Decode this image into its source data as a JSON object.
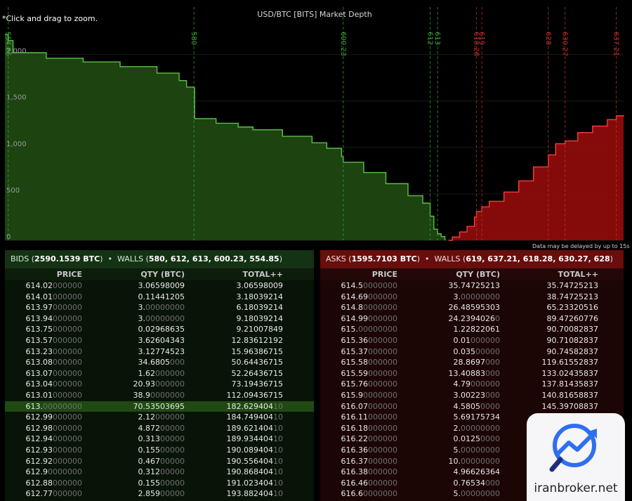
{
  "hint": "*Click and drag to zoom.",
  "delay_note": "Data may be delayed by up to 15s",
  "colors": {
    "bid": "#1f4a12",
    "bid_line": "#5cc24a",
    "ask": "#8c0c0c",
    "ask_line": "#ff3a3a"
  },
  "chart_data": {
    "type": "area",
    "title": "USD/BTC [BITS] Market Depth",
    "ylim": [
      0,
      2300
    ],
    "xlim": [
      554.4,
      638.2
    ],
    "y_ticks": [
      "0",
      "500",
      "1,000",
      "1,500",
      "2,000"
    ],
    "wall_labels": {
      "bids": [
        "554.85",
        "580",
        "600.23",
        "612",
        "613"
      ],
      "asks": [
        "618.28",
        "619",
        "628",
        "630.27",
        "637.21"
      ]
    },
    "bid_walls": [
      554.85,
      580,
      600.23,
      612,
      613
    ],
    "ask_walls": [
      618.28,
      619,
      628,
      630.27,
      637.21
    ],
    "series": [
      {
        "name": "Bids",
        "x": [
          554.4,
          554.85,
          555.5,
          560,
          565,
          570,
          575,
          578,
          579,
          580,
          580.1,
          583,
          586,
          588,
          592,
          596,
          598,
          600,
          600.23,
          603,
          606,
          609,
          611,
          612,
          612.5,
          613,
          613.5,
          614,
          614.02
        ],
        "y": [
          2215,
          2150,
          2020,
          1960,
          1920,
          1870,
          1800,
          1720,
          1650,
          1640,
          1310,
          1260,
          1220,
          1190,
          1120,
          1050,
          990,
          900,
          840,
          730,
          610,
          480,
          400,
          260,
          120,
          70,
          40,
          10,
          0
        ]
      },
      {
        "name": "Asks",
        "x": [
          614.5,
          615,
          616,
          617,
          618,
          618.28,
          619,
          620,
          622,
          624,
          626,
          628,
          629,
          630.27,
          632,
          634,
          636,
          637.21,
          638.2
        ],
        "y": [
          0,
          35,
          90,
          150,
          250,
          310,
          360,
          420,
          520,
          640,
          790,
          920,
          1040,
          1070,
          1160,
          1230,
          1300,
          1340,
          1350
        ]
      }
    ]
  },
  "bids": {
    "label": "BIDS",
    "total": "2590.1539 BTC",
    "walls_label": "WALLS",
    "walls": "580, 612, 613, 600.23, 554.85",
    "columns": [
      "PRICE",
      "QTY (BTC)",
      "TOTAL++"
    ],
    "rows": [
      [
        "614.02",
        "000000",
        "3.06598009",
        "",
        "3.06598009",
        ""
      ],
      [
        "614.01",
        "000000",
        "0.11441205",
        "",
        "3.18039214",
        ""
      ],
      [
        "613.97",
        "000000",
        "3.",
        "00000000",
        "6.18039214",
        ""
      ],
      [
        "613.94",
        "000000",
        "3.",
        "00000000",
        "9.18039214",
        ""
      ],
      [
        "613.75",
        "000000",
        "0.02968635",
        "",
        "9.21007849",
        ""
      ],
      [
        "613.57",
        "000000",
        "3.62604343",
        "",
        "12.83612192",
        ""
      ],
      [
        "613.23",
        "000000",
        "3.12774523",
        "",
        "15.96386715",
        ""
      ],
      [
        "613.08",
        "000000",
        "34.6805",
        "000",
        "50.64436715",
        ""
      ],
      [
        "613.07",
        "000000",
        "1.62",
        "000000",
        "52.26436715",
        ""
      ],
      [
        "613.04",
        "000000",
        "20.93",
        "000000",
        "73.19436715",
        ""
      ],
      [
        "613.01",
        "000000",
        "38.9",
        "0000000",
        "112.09436715",
        ""
      ],
      [
        "613.",
        "00000000",
        "70.53503695",
        "",
        "182.629404",
        "10"
      ],
      [
        "612.99",
        "000000",
        "2.12",
        "000000",
        "184.749404",
        "10"
      ],
      [
        "612.98",
        "000000",
        "4.872",
        "00000",
        "189.621404",
        "10"
      ],
      [
        "612.94",
        "000000",
        "0.313",
        "00000",
        "189.934404",
        "10"
      ],
      [
        "612.93",
        "000000",
        "0.155",
        "00000",
        "190.089404",
        "10"
      ],
      [
        "612.92",
        "000000",
        "0.467",
        "00000",
        "190.556404",
        "10"
      ],
      [
        "612.9",
        "0000000",
        "0.312",
        "00000",
        "190.868404",
        "10"
      ],
      [
        "612.88",
        "000000",
        "0.155",
        "00000",
        "191.023404",
        "10"
      ],
      [
        "612.77",
        "000000",
        "2.859",
        "00000",
        "193.882404",
        "10"
      ]
    ]
  },
  "asks": {
    "label": "ASKS",
    "total": "1595.7103 BTC",
    "walls_label": "WALLS",
    "walls": "619, 637.21, 618.28, 630.27, 628",
    "columns": [
      "PRICE",
      "QTY (BTC)",
      "TOTAL++"
    ],
    "rows": [
      [
        "614.5",
        "0000000",
        "35.74725213",
        "",
        "35.74725213",
        ""
      ],
      [
        "614.69",
        "000000",
        "3.",
        "00000000",
        "38.74725213",
        ""
      ],
      [
        "614.8",
        "0000000",
        "26.48595303",
        "",
        "65.23320516",
        ""
      ],
      [
        "614.99",
        "000000",
        "24.2394026",
        "0",
        "89.47260776",
        ""
      ],
      [
        "615.",
        "00000000",
        "1.22822061",
        "",
        "90.70082837",
        ""
      ],
      [
        "615.36",
        "000000",
        "0.01",
        "000000",
        "90.71082837",
        ""
      ],
      [
        "615.37",
        "000000",
        "0.035",
        "00000",
        "90.74582837",
        ""
      ],
      [
        "615.58",
        "000000",
        "28.8697",
        "000",
        "119.61552837",
        ""
      ],
      [
        "615.59",
        "000000",
        "13.40883",
        "000",
        "133.02435837",
        ""
      ],
      [
        "615.76",
        "000000",
        "4.79",
        "000000",
        "137.81435837",
        ""
      ],
      [
        "615.9",
        "0000000",
        "3.00223",
        "000",
        "140.81658837",
        ""
      ],
      [
        "616.07",
        "000000",
        "4.5805",
        "0000",
        "145.39708837",
        ""
      ],
      [
        "616.11",
        "000000",
        "5.69175734",
        "",
        "",
        ""
      ],
      [
        "616.18",
        "000000",
        "2.",
        "00000000",
        "",
        ""
      ],
      [
        "616.22",
        "000000",
        "0.0125",
        "0000",
        "",
        ""
      ],
      [
        "616.36",
        "000000",
        "5.",
        "00000000",
        "",
        ""
      ],
      [
        "616.37",
        "000000",
        "10.",
        "00000000",
        "",
        ""
      ],
      [
        "616.38",
        "000000",
        "4.96626364",
        "",
        "",
        ""
      ],
      [
        "616.46",
        "000000",
        "0.76534",
        "000",
        "",
        ""
      ],
      [
        "616.6",
        "0000000",
        "5.",
        "00000000",
        "",
        ""
      ]
    ]
  },
  "watermark": {
    "text": "iranbroker.net"
  }
}
